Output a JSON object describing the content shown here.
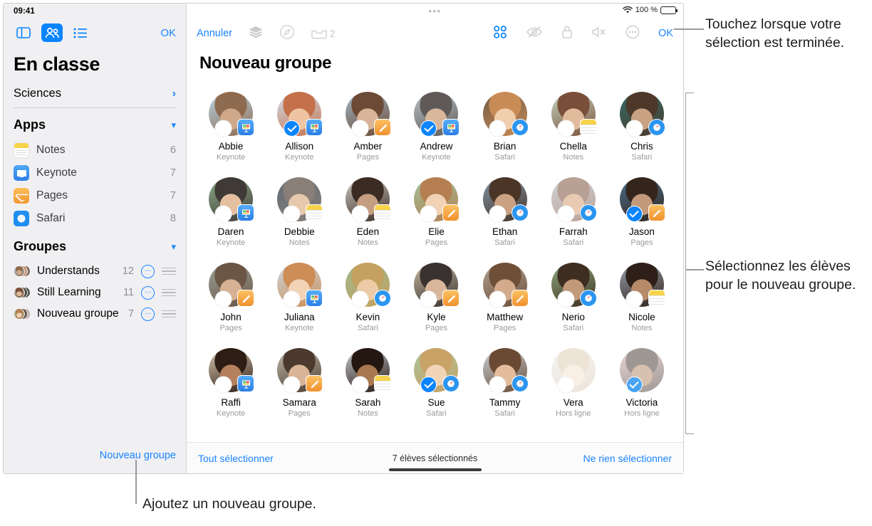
{
  "status_bar": {
    "time": "09:41",
    "wifi_icon": "wifi-icon",
    "battery_percent": "100 %"
  },
  "sidebar": {
    "toolbar": {
      "sidebar_toggle_icon": "sidebar-layout-icon",
      "people_icon": "people-icon",
      "list_icon": "list-icon",
      "done_label": "OK"
    },
    "class_title": "En classe",
    "class_row": {
      "label": "Sciences",
      "chevron": "chevron-right-icon"
    },
    "apps_section": {
      "title": "Apps",
      "caret": "chevron-down-icon"
    },
    "apps": [
      {
        "name": "Notes",
        "count": "6",
        "icon": "notes-app-icon"
      },
      {
        "name": "Keynote",
        "count": "7",
        "icon": "keynote-app-icon"
      },
      {
        "name": "Pages",
        "count": "7",
        "icon": "pages-app-icon"
      },
      {
        "name": "Safari",
        "count": "8",
        "icon": "safari-app-icon"
      }
    ],
    "groups_section": {
      "title": "Groupes",
      "caret": "chevron-down-icon"
    },
    "groups": [
      {
        "name": "Understands",
        "count": "12",
        "more": "…",
        "reorder": "reorder-handle-icon"
      },
      {
        "name": "Still Learning",
        "count": "11",
        "more": "…",
        "reorder": "reorder-handle-icon"
      },
      {
        "name": "Nouveau groupe",
        "count": "7",
        "more": "…",
        "reorder": "reorder-handle-icon"
      }
    ],
    "new_group_link": "Nouveau groupe"
  },
  "main": {
    "toolbar": {
      "cancel_label": "Annuler",
      "layers_icon": "layers-icon",
      "navigate_icon": "navigate-compass-icon",
      "inbox_icon": "inbox-tray-icon",
      "inbox_count": "2",
      "grid_icon": "grid-view-icon",
      "hide_icon": "eye-slash-icon",
      "lock_icon": "lock-icon",
      "mute_icon": "speaker-mute-icon",
      "more_icon": "ellipsis-circle-icon",
      "done_label": "OK"
    },
    "title": "Nouveau groupe",
    "students": [
      {
        "name": "Abbie",
        "app": "Keynote",
        "selected": false,
        "badge": "keynote",
        "offline": false
      },
      {
        "name": "Allison",
        "app": "Keynote",
        "selected": true,
        "badge": "keynote",
        "offline": false
      },
      {
        "name": "Amber",
        "app": "Pages",
        "selected": false,
        "badge": "pages",
        "offline": false
      },
      {
        "name": "Andrew",
        "app": "Keynote",
        "selected": true,
        "badge": "keynote",
        "offline": false
      },
      {
        "name": "Brian",
        "app": "Safari",
        "selected": false,
        "badge": "safari",
        "offline": false
      },
      {
        "name": "Chella",
        "app": "Notes",
        "selected": false,
        "badge": "notes",
        "offline": false
      },
      {
        "name": "Chris",
        "app": "Safari",
        "selected": false,
        "badge": "safari",
        "offline": false
      },
      {
        "name": "Daren",
        "app": "Keynote",
        "selected": false,
        "badge": "keynote",
        "offline": false
      },
      {
        "name": "Debbie",
        "app": "Notes",
        "selected": false,
        "badge": "notes",
        "offline": false
      },
      {
        "name": "Eden",
        "app": "Notes",
        "selected": false,
        "badge": "notes",
        "offline": false
      },
      {
        "name": "Elie",
        "app": "Pages",
        "selected": false,
        "badge": "pages",
        "offline": false
      },
      {
        "name": "Ethan",
        "app": "Safari",
        "selected": false,
        "badge": "safari",
        "offline": false
      },
      {
        "name": "Farrah",
        "app": "Safari",
        "selected": false,
        "badge": "safari",
        "offline": false
      },
      {
        "name": "Jason",
        "app": "Pages",
        "selected": true,
        "badge": "pages",
        "offline": false
      },
      {
        "name": "John",
        "app": "Pages",
        "selected": false,
        "badge": "pages",
        "offline": false
      },
      {
        "name": "Juliana",
        "app": "Keynote",
        "selected": false,
        "badge": "keynote",
        "offline": false
      },
      {
        "name": "Kevin",
        "app": "Safari",
        "selected": false,
        "badge": "safari",
        "offline": false
      },
      {
        "name": "Kyle",
        "app": "Pages",
        "selected": false,
        "badge": "pages",
        "offline": false
      },
      {
        "name": "Matthew",
        "app": "Pages",
        "selected": false,
        "badge": "pages",
        "offline": false
      },
      {
        "name": "Nerio",
        "app": "Safari",
        "selected": false,
        "badge": "safari",
        "offline": false
      },
      {
        "name": "Nicole",
        "app": "Notes",
        "selected": false,
        "badge": "notes",
        "offline": false
      },
      {
        "name": "Raffi",
        "app": "Keynote",
        "selected": false,
        "badge": "keynote",
        "offline": false
      },
      {
        "name": "Samara",
        "app": "Pages",
        "selected": false,
        "badge": "pages",
        "offline": false
      },
      {
        "name": "Sarah",
        "app": "Notes",
        "selected": false,
        "badge": "notes",
        "offline": false
      },
      {
        "name": "Sue",
        "app": "Safari",
        "selected": true,
        "badge": "safari",
        "offline": false
      },
      {
        "name": "Tammy",
        "app": "Safari",
        "selected": false,
        "badge": "safari",
        "offline": false
      },
      {
        "name": "Vera",
        "app": "Hors ligne",
        "selected": false,
        "badge": "none",
        "offline": true
      },
      {
        "name": "Victoria",
        "app": "Hors ligne",
        "selected": true,
        "badge": "none",
        "offline": true
      }
    ],
    "footer": {
      "select_all": "Tout sélectionner",
      "status": "7 élèves sélectionnés",
      "select_none": "Ne rien sélectionner"
    }
  },
  "callouts": {
    "top_right": "Touchez lorsque votre sélection est terminée.",
    "mid_right": "Sélectionnez les élèves pour le nouveau groupe.",
    "bottom": "Ajoutez un nouveau groupe."
  },
  "colors": {
    "accent_blue": "#0a84ff",
    "link_blue": "#1a84ff",
    "sidebar_bg": "#f0f0f3",
    "muted_gray": "#9a9aa0"
  }
}
